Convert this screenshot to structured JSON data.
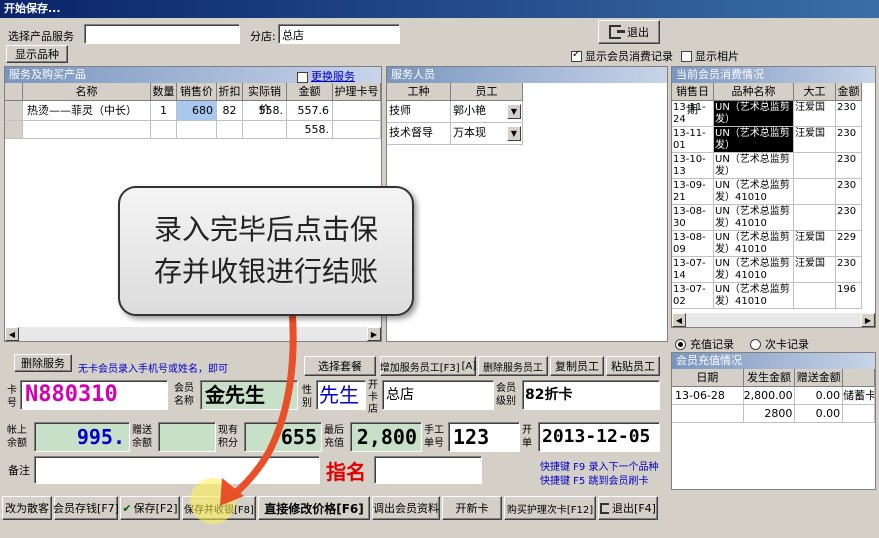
{
  "window": {
    "title": "开始保存..."
  },
  "top": {
    "product_label": "选择产品服务",
    "product_value": "",
    "branch_label": "分店:",
    "branch_value": "总店",
    "show_products_btn": "显示品种",
    "exit_btn": "退出",
    "show_member_consumption": "显示会员消费记录",
    "show_member_consumption_checked": true,
    "show_photos": "显示相片",
    "show_photos_checked": false
  },
  "services": {
    "header": "服务及购买产品",
    "change_service": "更换服务",
    "columns": [
      "名称",
      "数量",
      "销售价",
      "折扣",
      "实际销价",
      "金额",
      "护理卡号"
    ],
    "rows": [
      [
        "热烫——菲灵（中长）",
        "1",
        "680",
        "82",
        "558.",
        "557.6",
        ""
      ],
      [
        "",
        "",
        "",
        "",
        "",
        "558.",
        ""
      ]
    ]
  },
  "staff": {
    "header": "服务人员",
    "columns": [
      "工种",
      "员工"
    ],
    "rows": [
      [
        "技师",
        "郭小艳"
      ],
      [
        "技术督导",
        "万本现"
      ]
    ]
  },
  "history": {
    "header": "当前会员消费情况",
    "columns": [
      "销售日期",
      "品种名称",
      "大工",
      "金额"
    ],
    "rows": [
      [
        "13-11-24",
        "UN（艺术总监剪发）",
        "汪爱国",
        "230"
      ],
      [
        "13-11-01",
        "UN（艺术总监剪发）",
        "汪爱国",
        "230"
      ],
      [
        "13-10-13",
        "UN（艺术总监剪发）",
        "",
        "230"
      ],
      [
        "13-09-21",
        "UN（艺术总监剪发）41010",
        "",
        "230"
      ],
      [
        "13-08-30",
        "UN（艺术总监剪发）41010",
        "",
        "230"
      ],
      [
        "13-08-09",
        "UN（艺术总监剪发）41010",
        "汪爱国",
        "229"
      ],
      [
        "13-07-14",
        "UN（艺术总监剪发）41010",
        "汪爱国",
        "230"
      ],
      [
        "13-07-02",
        "UN（艺术总监剪发）41010",
        "",
        "196"
      ]
    ]
  },
  "record_type": {
    "recharge": "充值记录",
    "times": "次卡记录"
  },
  "recharge": {
    "header": "会员充值情况",
    "columns": [
      "日期",
      "发生金额",
      "赠送金额",
      ""
    ],
    "rows": [
      [
        "13-06-28",
        "2,800.00",
        "0.00",
        "储蓄卡"
      ],
      [
        "",
        "2800",
        "0.00",
        ""
      ]
    ]
  },
  "callout": {
    "text": "录入完毕后点击保存并收银进行结账"
  },
  "actions": {
    "delete_service": "删除服务",
    "hint": "无卡会员录入手机号或姓名，即可",
    "select_package": "选择套餐",
    "add_staff": "增加服务员工[F3]",
    "add_staff_a": "[A]",
    "delete_staff": "删除服务员工",
    "copy_staff": "复制员工",
    "paste_staff": "粘贴员工"
  },
  "member": {
    "card_label": "卡号",
    "card_value": "N880310",
    "name_label": "会员名称",
    "name_value": "金先生",
    "gender_label": "性别",
    "gender_value": "先生",
    "store_label": "开卡店",
    "store_value": "总店",
    "level_label": "会员级别",
    "level_value": "82折卡",
    "balance_label": "帐上余额",
    "balance_value": "995.",
    "gift_label": "赠送余额",
    "gift_value": "",
    "points_label": "现有积分",
    "points_value": "655",
    "last_recharge_label": "最后充值",
    "last_recharge_value": "2,800",
    "manual_no_label": "手工单号",
    "manual_no_value": "123",
    "open_date_label": "开单",
    "open_date_value": "2013-12-05",
    "remark_label": "备注",
    "remark_value": "",
    "designate": "指名",
    "shortcut1": "快捷键 F9 录入下一个品种",
    "shortcut2": "快捷键 F5 跳到会员刷卡"
  },
  "bottom": {
    "b1": "改为散客",
    "b2": "会员存钱[F7]",
    "b3": "保存[F2]",
    "b4": "保存并收银[F8]",
    "b5": "直接修改价格[F6]",
    "b6": "调出会员资料",
    "b7": "开新卡",
    "b8": "购买护理次卡[F12]",
    "b9": "退出[F4]"
  },
  "colors": {
    "accent_blue": "#0a246a",
    "card_magenta": "#d400b4",
    "balance_blue": "#0000c8",
    "designate_red": "#e00000",
    "arrow": "#e8502a"
  }
}
